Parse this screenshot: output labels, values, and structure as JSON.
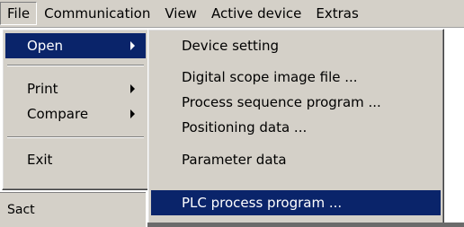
{
  "menubar": {
    "items": [
      "File",
      "Communication",
      "View",
      "Active device",
      "Extras"
    ]
  },
  "file_menu": {
    "items": [
      {
        "label": "Open",
        "has_submenu": true
      },
      {
        "label": "Print",
        "has_submenu": true
      },
      {
        "label": "Compare",
        "has_submenu": true
      },
      {
        "label": "Exit",
        "has_submenu": false
      }
    ]
  },
  "open_submenu": {
    "items": [
      "Device setting",
      "Digital scope image file ...",
      "Process sequence program ...",
      "Positioning data ...",
      "Parameter data",
      "PLC process program ..."
    ]
  },
  "status_text": "Sact",
  "colors": {
    "highlight": "#0a246a",
    "face": "#d4d0c8"
  }
}
